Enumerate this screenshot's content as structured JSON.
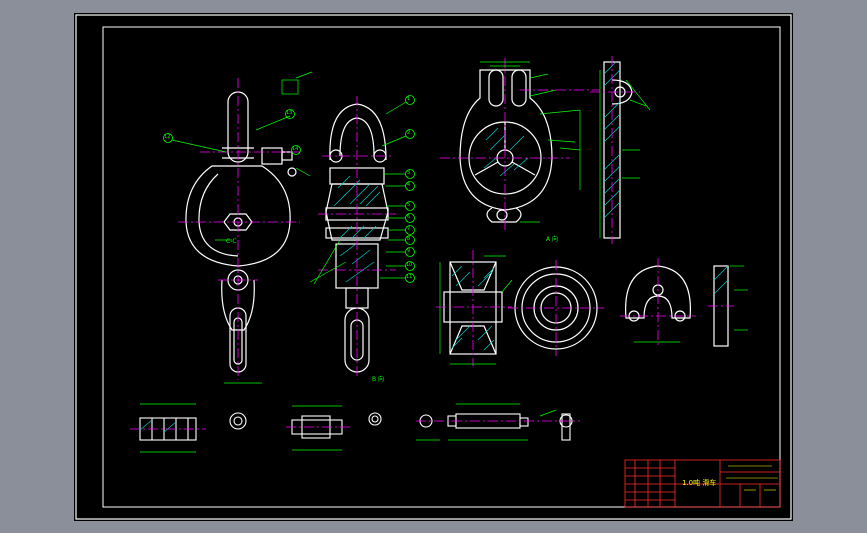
{
  "colors": {
    "background": "#8b8f99",
    "sheet": "#000000",
    "outline": "#ffffff",
    "centerline": "#ff00ff",
    "dimension": "#00ff00",
    "hatch": "#00c8c8",
    "title_block": "#ff2a2a",
    "title_text": "#ffff00"
  },
  "labels": {
    "view_a": "A 向",
    "view_b": "B 向",
    "section_c": "C-C",
    "title": "1.0吨 滑车"
  },
  "balloons": [
    "1",
    "2",
    "3",
    "4",
    "5",
    "6",
    "7",
    "8",
    "9",
    "10",
    "11",
    "12",
    "13",
    "14"
  ]
}
